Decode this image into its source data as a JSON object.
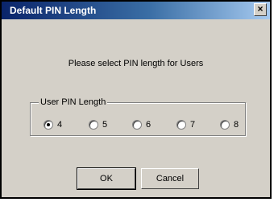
{
  "window": {
    "title": "Default PIN Length",
    "close_label": "×"
  },
  "prompt_text": "Please select PIN length for Users",
  "group": {
    "label": "User PIN Length",
    "selected": "4",
    "options": [
      "4",
      "5",
      "6",
      "7",
      "8"
    ]
  },
  "buttons": {
    "ok_label": "OK",
    "cancel_label": "Cancel"
  },
  "colors": {
    "titlebar_start": "#0a246a",
    "titlebar_end": "#a6caf0",
    "dialog_bg": "#d4d0c8"
  }
}
